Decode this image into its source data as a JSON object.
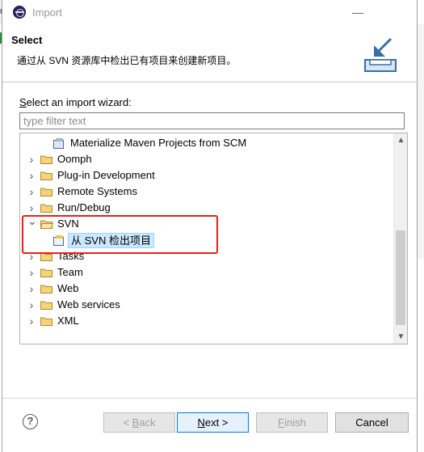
{
  "window": {
    "title": "Import",
    "minimize": "—",
    "maximize": "☐",
    "close": "✕"
  },
  "background": {
    "left_fragment": "nc"
  },
  "header": {
    "title": "Select",
    "description": "通过从 SVN 资源库中检出已有项目来创建新项目。"
  },
  "wizard": {
    "label_prefix": "",
    "label_mnemonic": "S",
    "label_rest": "elect an import wizard:",
    "filter_placeholder": "type filter text",
    "filter_value": ""
  },
  "tree": {
    "items": [
      {
        "label": "Materialize Maven Projects from SCM",
        "type": "item",
        "expanded": false
      },
      {
        "label": "Oomph",
        "type": "folder",
        "expanded": false
      },
      {
        "label": "Plug-in Development",
        "type": "folder",
        "expanded": false
      },
      {
        "label": "Remote Systems",
        "type": "folder",
        "expanded": false
      },
      {
        "label": "Run/Debug",
        "type": "folder",
        "expanded": false
      },
      {
        "label": "SVN",
        "type": "folder",
        "expanded": true
      },
      {
        "label": "从 SVN 检出项目",
        "type": "item",
        "selected": true
      },
      {
        "label": "Tasks",
        "type": "folder",
        "expanded": false
      },
      {
        "label": "Team",
        "type": "folder",
        "expanded": false
      },
      {
        "label": "Web",
        "type": "folder",
        "expanded": false
      },
      {
        "label": "Web services",
        "type": "folder",
        "expanded": false
      },
      {
        "label": "XML",
        "type": "folder",
        "expanded": false
      }
    ]
  },
  "buttons": {
    "help": "?",
    "back_pre": "< ",
    "back_mn": "B",
    "back_post": "ack",
    "next_mn": "N",
    "next_post": "ext >",
    "finish_mn": "F",
    "finish_post": "inish",
    "cancel": "Cancel"
  },
  "colors": {
    "accent": "#0078d7",
    "highlight_box": "#e62020",
    "selection": "#cce8ff",
    "folder": "#e8b94a"
  }
}
